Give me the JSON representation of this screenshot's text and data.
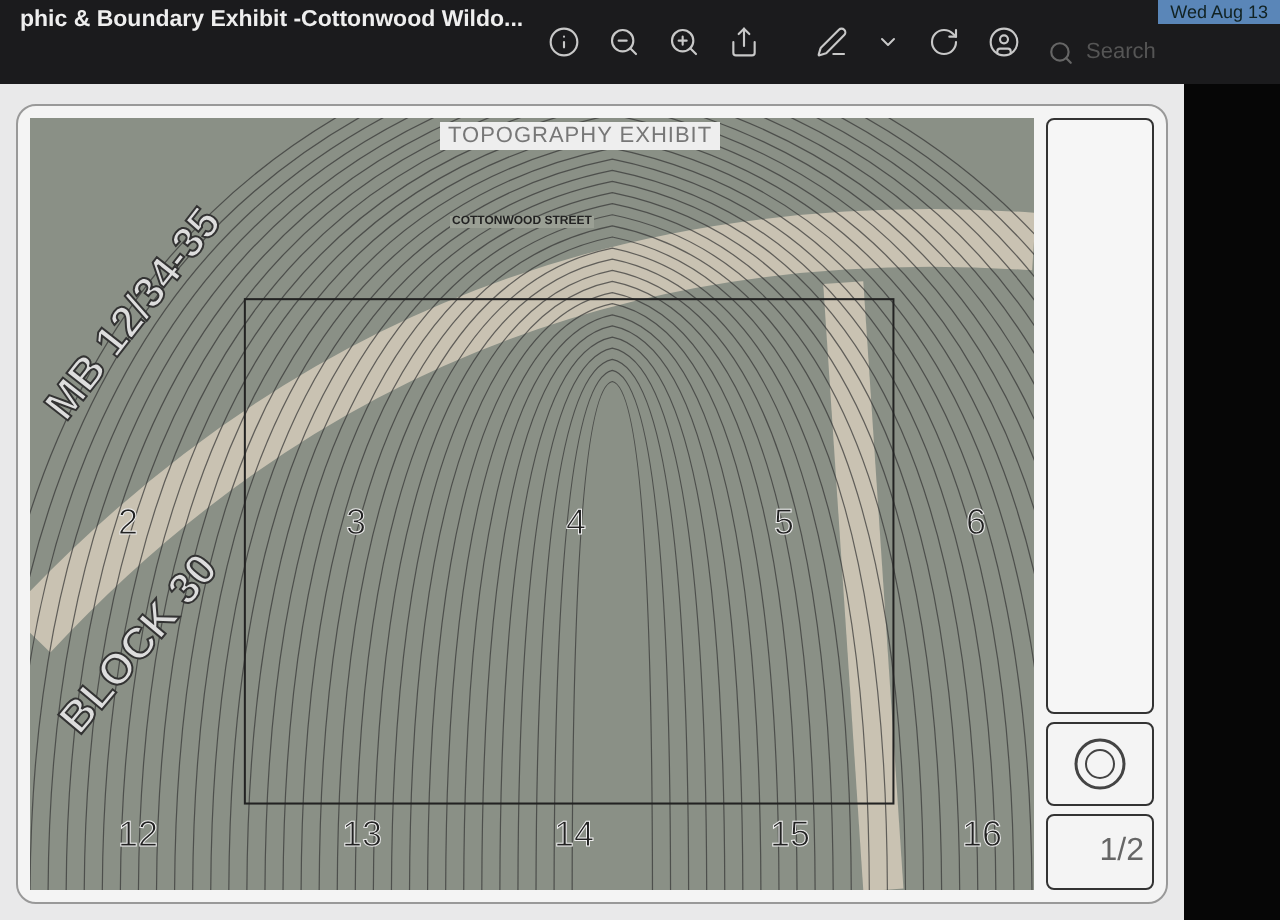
{
  "window": {
    "title": "phic & Boundary Exhibit -Cottonwood Wildo..."
  },
  "toolbar": {
    "search": {
      "placeholder": "Search"
    }
  },
  "menu_bar": {
    "clock": "Wed Aug 13"
  },
  "map": {
    "title": "TOPOGRAPHY EXHIBIT",
    "street": "COTTONWOOD STREET",
    "tract_labels": [
      {
        "text": "MB 12/34-35",
        "kind": "map-book"
      },
      {
        "text": "BLOCK 30",
        "kind": "block"
      }
    ],
    "lots": [
      {
        "number": "2"
      },
      {
        "number": "3"
      },
      {
        "number": "4"
      },
      {
        "number": "5"
      },
      {
        "number": "6"
      },
      {
        "number": "12"
      },
      {
        "number": "13"
      },
      {
        "number": "14"
      },
      {
        "number": "15"
      },
      {
        "number": "16"
      }
    ]
  },
  "title_block": {
    "sheet": "1/2"
  }
}
